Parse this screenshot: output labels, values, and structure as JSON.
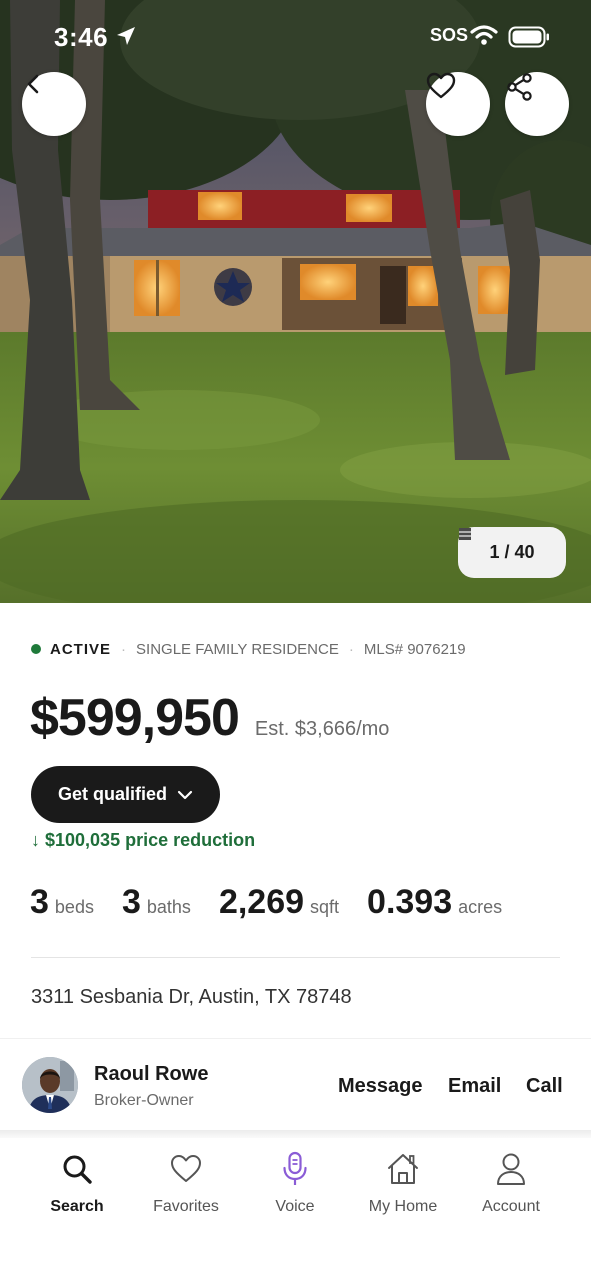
{
  "status_bar": {
    "time": "3:46",
    "carrier": "SOS"
  },
  "gallery": {
    "counter": "1 / 40"
  },
  "listing": {
    "status": "ACTIVE",
    "property_type": "SINGLE FAMILY RESIDENCE",
    "mls": "MLS# 9076219",
    "price": "$599,950",
    "estimate": "Est. $3,666/mo",
    "qualify_label": "Get qualified",
    "price_reduction": "↓ $100,035 price reduction",
    "facts": [
      {
        "value": "3",
        "unit": "beds"
      },
      {
        "value": "3",
        "unit": "baths"
      },
      {
        "value": "2,269",
        "unit": "sqft"
      },
      {
        "value": "0.393",
        "unit": "acres"
      }
    ],
    "address": "3311 Sesbania Dr, Austin, TX 78748"
  },
  "agent": {
    "name": "Raoul Rowe",
    "role": "Broker-Owner",
    "actions": [
      "Message",
      "Email",
      "Call"
    ]
  },
  "tabs": [
    {
      "label": "Search",
      "icon": "search-icon",
      "active": true
    },
    {
      "label": "Favorites",
      "icon": "heart-icon",
      "active": false
    },
    {
      "label": "Voice",
      "icon": "microphone-icon",
      "active": false
    },
    {
      "label": "My Home",
      "icon": "home-icon",
      "active": false
    },
    {
      "label": "Account",
      "icon": "person-icon",
      "active": false
    }
  ],
  "colors": {
    "active_status": "#1f7a3a",
    "price_reduction": "#1f6e3a",
    "voice_accent": "#8a5cd6",
    "primary_button": "#1a1a1a"
  }
}
